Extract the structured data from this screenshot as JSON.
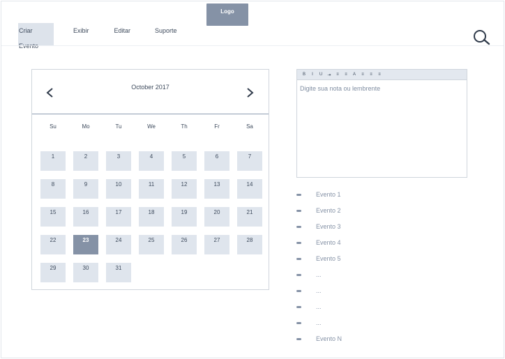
{
  "header": {
    "logo_label": "Logo",
    "nav": [
      {
        "label": "Criar Evento",
        "active": true
      },
      {
        "label": "Exibir",
        "active": false
      },
      {
        "label": "Editar",
        "active": false
      },
      {
        "label": "Suporte",
        "active": false
      }
    ],
    "search_icon": "search-icon"
  },
  "calendar": {
    "title": "October 2017",
    "prev_icon": "chevron-left-icon",
    "next_icon": "chevron-right-icon",
    "weekdays": [
      "Su",
      "Mo",
      "Tu",
      "We",
      "Th",
      "Fr",
      "Sa"
    ],
    "days": [
      "1",
      "2",
      "3",
      "4",
      "5",
      "6",
      "7",
      "8",
      "9",
      "10",
      "11",
      "12",
      "13",
      "14",
      "15",
      "16",
      "17",
      "18",
      "19",
      "20",
      "21",
      "22",
      "23",
      "24",
      "25",
      "26",
      "27",
      "28",
      "29",
      "30",
      "31"
    ],
    "selected_day": "23"
  },
  "editor": {
    "toolbar": [
      "B",
      "I",
      "U",
      "⇥",
      "≡",
      "≡",
      "A",
      "≡",
      "≡",
      "≡"
    ],
    "placeholder": "Digite sua nota ou lembrente"
  },
  "events": [
    "Evento 1",
    "Evento 2",
    "Evento 3",
    "Evento 4",
    "Evento 5",
    "...",
    "...",
    "...",
    "...",
    "Evento N"
  ],
  "colors": {
    "accent": "#8592a6",
    "day_bg": "#dfe5ed",
    "nav_active_bg": "#dde3eb"
  }
}
